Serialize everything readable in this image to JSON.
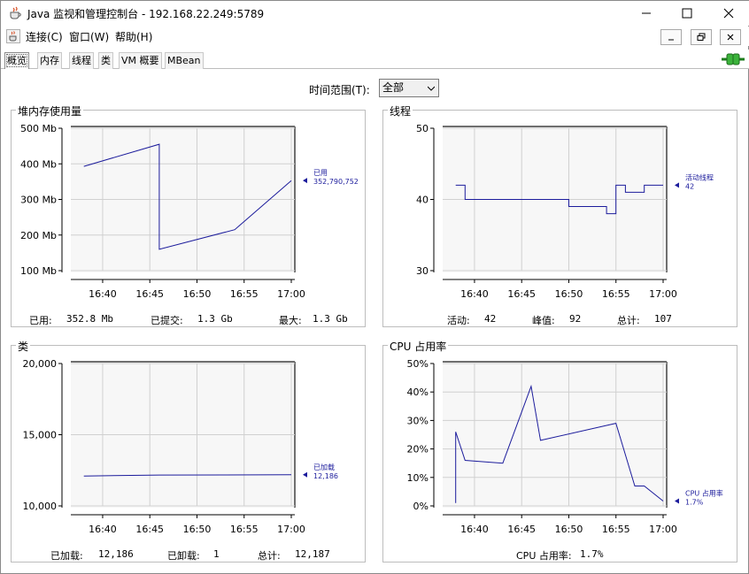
{
  "window": {
    "title": "Java 监视和管理控制台 - 192.168.22.249:5789",
    "controls": [
      "minimize",
      "maximize",
      "close"
    ]
  },
  "menu": {
    "items": [
      "连接(C)",
      "窗口(W)",
      "帮助(H)"
    ]
  },
  "tabs": [
    "概览",
    "内存",
    "线程",
    "类",
    "VM 概要",
    "MBean"
  ],
  "active_tab": "概览",
  "time_range": {
    "label": "时间范围(T):",
    "selected": "全部"
  },
  "x_ticks": [
    "16:40",
    "16:45",
    "16:50",
    "16:55",
    "17:00"
  ],
  "panels": {
    "heap": {
      "title": "堆内存使用量",
      "y_ticks": [
        "500 Mb",
        "400 Mb",
        "300 Mb",
        "200 Mb",
        "100 Mb"
      ],
      "legend_name": "已用",
      "legend_value": "352,790,752",
      "stats": [
        {
          "label": "已用:",
          "value": "352.8  Mb"
        },
        {
          "label": "已提交:",
          "value": "1.3  Gb"
        },
        {
          "label": "最大:",
          "value": "1.3  Gb"
        }
      ]
    },
    "threads": {
      "title": "线程",
      "y_ticks": [
        "50",
        "40",
        "30"
      ],
      "legend_name": "活动线程",
      "legend_value": "42",
      "stats": [
        {
          "label": "活动:",
          "value": "42"
        },
        {
          "label": "峰值:",
          "value": "92"
        },
        {
          "label": "总计:",
          "value": "107"
        }
      ]
    },
    "classes": {
      "title": "类",
      "y_ticks": [
        "20,000",
        "15,000",
        "10,000"
      ],
      "legend_name": "已加载",
      "legend_value": "12,186",
      "stats": [
        {
          "label": "已加载:",
          "value": "12,186"
        },
        {
          "label": "已卸载:",
          "value": "1"
        },
        {
          "label": "总计:",
          "value": "12,187"
        }
      ]
    },
    "cpu": {
      "title": "CPU 占用率",
      "y_ticks": [
        "50%",
        "40%",
        "30%",
        "20%",
        "10%",
        "0%"
      ],
      "legend_name": "CPU 占用率",
      "legend_value": "1.7%",
      "stats": [
        {
          "label": "CPU 占用率:",
          "value": "1.7%"
        }
      ]
    }
  },
  "colors": {
    "series": "#1c1c9c",
    "grid": "#d0d0d0",
    "axis": "#000000"
  },
  "chart_data": [
    {
      "type": "line",
      "title": "堆内存使用量",
      "ylabel": "Mb",
      "ylim": [
        100,
        500
      ],
      "series": [
        {
          "name": "已用",
          "x": [
            "16:38",
            "16:46",
            "16:46",
            "16:54",
            "17:00"
          ],
          "values": [
            393,
            455,
            160,
            215,
            353
          ]
        }
      ]
    },
    {
      "type": "line",
      "title": "线程",
      "ylim": [
        30,
        50
      ],
      "series": [
        {
          "name": "活动线程",
          "x": [
            "16:38",
            "16:39",
            "16:39",
            "16:50",
            "16:50",
            "16:54",
            "16:54",
            "16:55",
            "16:55",
            "16:56",
            "16:56",
            "16:58",
            "16:58",
            "17:00"
          ],
          "values": [
            42,
            42,
            40,
            40,
            39,
            39,
            38,
            38,
            42,
            42,
            41,
            41,
            42,
            42
          ]
        }
      ]
    },
    {
      "type": "line",
      "title": "类",
      "ylim": [
        10000,
        20000
      ],
      "series": [
        {
          "name": "已加载",
          "x": [
            "16:38",
            "16:46",
            "17:00"
          ],
          "values": [
            12100,
            12170,
            12186
          ]
        }
      ]
    },
    {
      "type": "line",
      "title": "CPU 占用率",
      "ylim": [
        0,
        50
      ],
      "series": [
        {
          "name": "CPU 占用率",
          "x": [
            "16:38",
            "16:38",
            "16:39",
            "16:43",
            "16:46",
            "16:47",
            "16:55",
            "16:57",
            "16:58",
            "17:00"
          ],
          "values": [
            1,
            26,
            16,
            15,
            42,
            23,
            29,
            7,
            7,
            1.7
          ]
        }
      ]
    }
  ]
}
